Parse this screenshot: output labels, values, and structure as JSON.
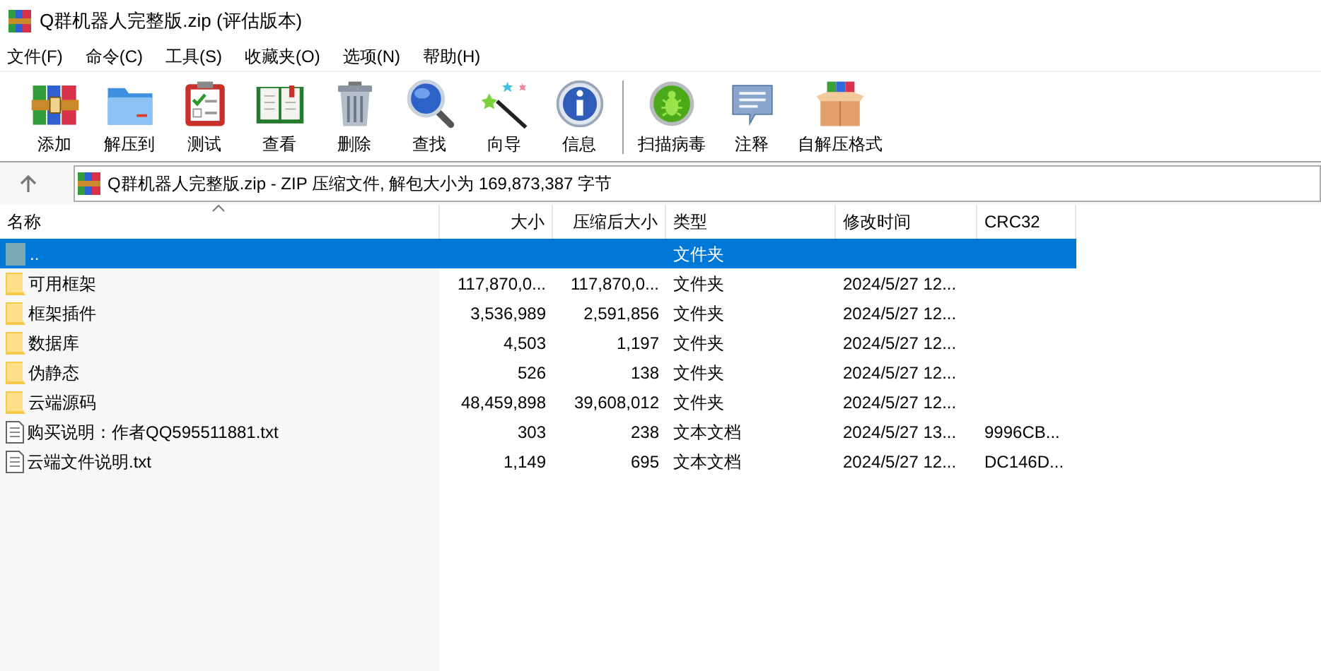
{
  "window": {
    "title": "Q群机器人完整版.zip (评估版本)"
  },
  "menu": [
    "文件(F)",
    "命令(C)",
    "工具(S)",
    "收藏夹(O)",
    "选项(N)",
    "帮助(H)"
  ],
  "toolbar": [
    {
      "label": "添加",
      "kind": "books"
    },
    {
      "label": "解压到",
      "kind": "folder"
    },
    {
      "label": "测试",
      "kind": "clipboard"
    },
    {
      "label": "查看",
      "kind": "book"
    },
    {
      "label": "删除",
      "kind": "trash"
    },
    {
      "label": "查找",
      "kind": "magnifier"
    },
    {
      "label": "向导",
      "kind": "wand"
    },
    {
      "label": "信息",
      "kind": "info"
    },
    {
      "label": "扫描病毒",
      "kind": "bug",
      "separator": true
    },
    {
      "label": "注释",
      "kind": "comment"
    },
    {
      "label": "自解压格式",
      "kind": "box"
    }
  ],
  "address": "Q群机器人完整版.zip - ZIP 压缩文件, 解包大小为 169,873,387 字节",
  "table": {
    "columns": [
      "名称",
      "大小",
      "压缩后大小",
      "类型",
      "修改时间",
      "CRC32"
    ],
    "rows": [
      {
        "kind": "parent",
        "name": "..",
        "size": "",
        "packed": "",
        "type": "文件夹",
        "modified": "",
        "crc": "",
        "selected": true
      },
      {
        "kind": "folder",
        "name": "可用框架",
        "size": "117,870,0...",
        "packed": "117,870,0...",
        "type": "文件夹",
        "modified": "2024/5/27 12...",
        "crc": "",
        "selected": false
      },
      {
        "kind": "folder",
        "name": "框架插件",
        "size": "3,536,989",
        "packed": "2,591,856",
        "type": "文件夹",
        "modified": "2024/5/27 12...",
        "crc": "",
        "selected": false
      },
      {
        "kind": "folder",
        "name": "数据库",
        "size": "4,503",
        "packed": "1,197",
        "type": "文件夹",
        "modified": "2024/5/27 12...",
        "crc": "",
        "selected": false
      },
      {
        "kind": "folder",
        "name": "伪静态",
        "size": "526",
        "packed": "138",
        "type": "文件夹",
        "modified": "2024/5/27 12...",
        "crc": "",
        "selected": false
      },
      {
        "kind": "folder",
        "name": "云端源码",
        "size": "48,459,898",
        "packed": "39,608,012",
        "type": "文件夹",
        "modified": "2024/5/27 12...",
        "crc": "",
        "selected": false
      },
      {
        "kind": "text",
        "name": "购买说明：作者QQ595511881.txt",
        "size": "303",
        "packed": "238",
        "type": "文本文档",
        "modified": "2024/5/27 13...",
        "crc": "9996CB...",
        "selected": false
      },
      {
        "kind": "text",
        "name": "云端文件说明.txt",
        "size": "1,149",
        "packed": "695",
        "type": "文本文档",
        "modified": "2024/5/27 12...",
        "crc": "DC146D...",
        "selected": false
      }
    ]
  }
}
